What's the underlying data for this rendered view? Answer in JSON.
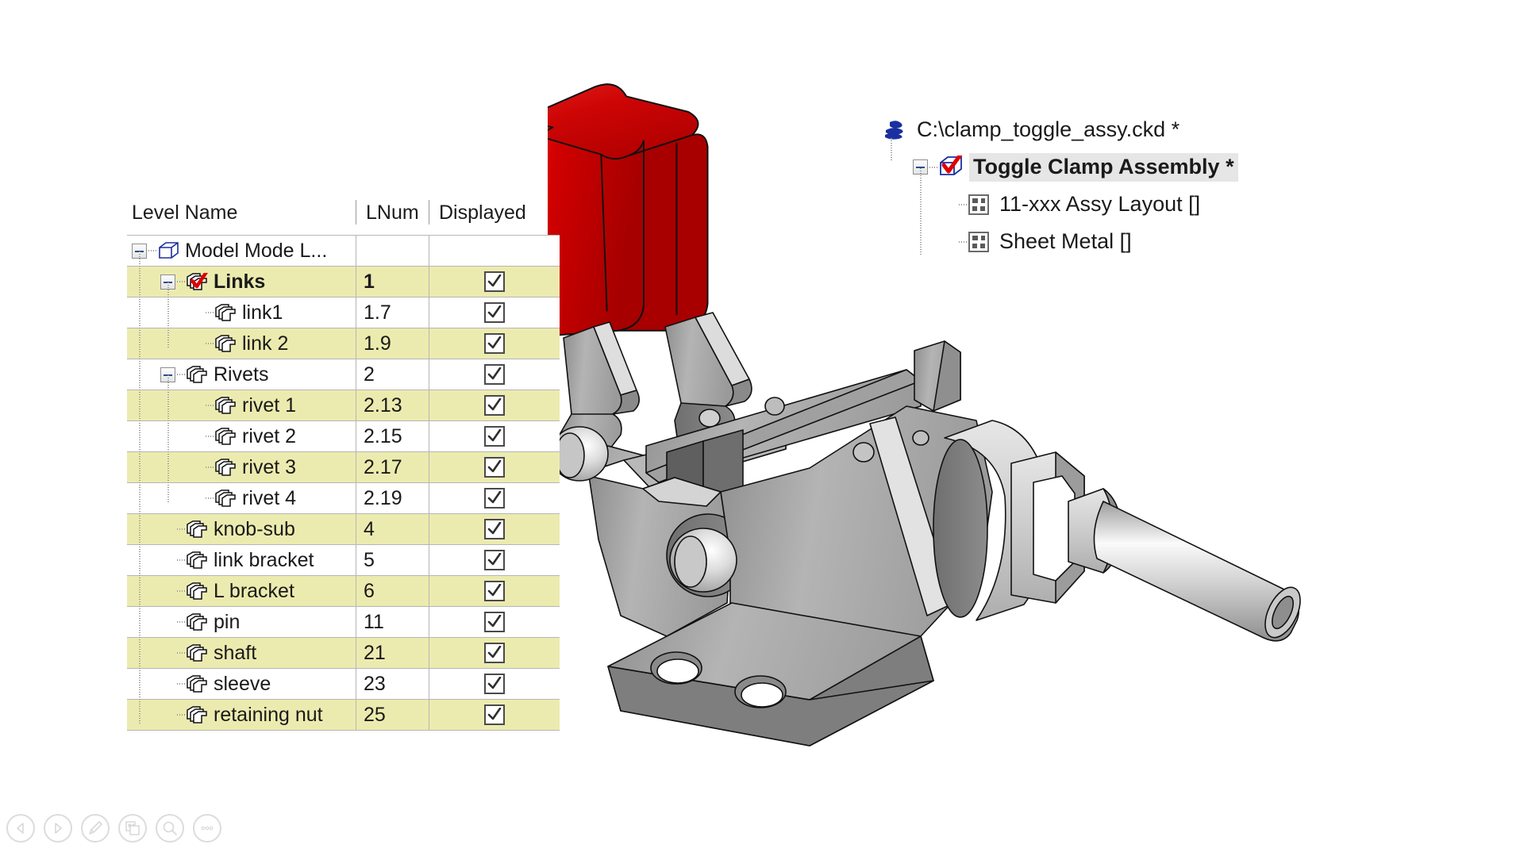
{
  "level_table": {
    "columns": [
      "Level Name",
      "LNum",
      "Displayed"
    ],
    "rows": [
      {
        "name": "Model Mode L...",
        "lnum": "",
        "displayed": false,
        "icon": "cube-icon",
        "depth": 0,
        "expander": "collapse",
        "bold": false,
        "alt": false,
        "has_check": false
      },
      {
        "name": "Links",
        "lnum": "1",
        "displayed": true,
        "icon": "stack-check-icon",
        "depth": 1,
        "expander": "collapse",
        "bold": true,
        "alt": true,
        "has_check": true
      },
      {
        "name": "link1",
        "lnum": "1.7",
        "displayed": true,
        "icon": "stack-icon",
        "depth": 2,
        "expander": "none",
        "bold": false,
        "alt": false,
        "has_check": true
      },
      {
        "name": "link 2",
        "lnum": "1.9",
        "displayed": true,
        "icon": "stack-icon",
        "depth": 2,
        "expander": "none",
        "bold": false,
        "alt": true,
        "has_check": true
      },
      {
        "name": "Rivets",
        "lnum": "2",
        "displayed": true,
        "icon": "stack-icon",
        "depth": 1,
        "expander": "collapse",
        "bold": false,
        "alt": false,
        "has_check": true
      },
      {
        "name": "rivet 1",
        "lnum": "2.13",
        "displayed": true,
        "icon": "stack-icon",
        "depth": 2,
        "expander": "none",
        "bold": false,
        "alt": true,
        "has_check": true
      },
      {
        "name": "rivet 2",
        "lnum": "2.15",
        "displayed": true,
        "icon": "stack-icon",
        "depth": 2,
        "expander": "none",
        "bold": false,
        "alt": false,
        "has_check": true
      },
      {
        "name": "rivet 3",
        "lnum": "2.17",
        "displayed": true,
        "icon": "stack-icon",
        "depth": 2,
        "expander": "none",
        "bold": false,
        "alt": true,
        "has_check": true
      },
      {
        "name": "rivet 4",
        "lnum": "2.19",
        "displayed": true,
        "icon": "stack-icon",
        "depth": 2,
        "expander": "none",
        "bold": false,
        "alt": false,
        "has_check": true
      },
      {
        "name": "knob-sub",
        "lnum": "4",
        "displayed": true,
        "icon": "stack-icon",
        "depth": 1,
        "expander": "none",
        "bold": false,
        "alt": true,
        "has_check": true
      },
      {
        "name": "link bracket",
        "lnum": "5",
        "displayed": true,
        "icon": "stack-icon",
        "depth": 1,
        "expander": "none",
        "bold": false,
        "alt": false,
        "has_check": true
      },
      {
        "name": "L bracket",
        "lnum": "6",
        "displayed": true,
        "icon": "stack-icon",
        "depth": 1,
        "expander": "none",
        "bold": false,
        "alt": true,
        "has_check": true
      },
      {
        "name": "pin",
        "lnum": "11",
        "displayed": true,
        "icon": "stack-icon",
        "depth": 1,
        "expander": "none",
        "bold": false,
        "alt": false,
        "has_check": true
      },
      {
        "name": "shaft",
        "lnum": "21",
        "displayed": true,
        "icon": "stack-icon",
        "depth": 1,
        "expander": "none",
        "bold": false,
        "alt": true,
        "has_check": true
      },
      {
        "name": "sleeve",
        "lnum": "23",
        "displayed": true,
        "icon": "stack-icon",
        "depth": 1,
        "expander": "none",
        "bold": false,
        "alt": false,
        "has_check": true
      },
      {
        "name": "retaining nut",
        "lnum": "25",
        "displayed": true,
        "icon": "stack-icon",
        "depth": 1,
        "expander": "none",
        "bold": false,
        "alt": true,
        "has_check": true
      }
    ]
  },
  "assembly_tree": {
    "nodes": [
      {
        "label": "C:\\clamp_toggle_assy.ckd *",
        "icon": "ckd-file-icon",
        "depth": 0,
        "expander": "none",
        "selected": false,
        "bold": false
      },
      {
        "label": "Toggle Clamp Assembly *",
        "icon": "cube-check-icon",
        "depth": 1,
        "expander": "collapse",
        "selected": true,
        "bold": true
      },
      {
        "label": "11-xxx Assy Layout []",
        "icon": "layout-icon",
        "depth": 2,
        "expander": "none",
        "selected": false,
        "bold": false
      },
      {
        "label": "Sheet Metal []",
        "icon": "layout-icon",
        "depth": 2,
        "expander": "none",
        "selected": false,
        "bold": false
      }
    ]
  },
  "model": {
    "name": "Toggle Clamp Assembly",
    "handle_color": "#D40000",
    "body_color": "#A8A8A8",
    "edge_color": "#1a1a1a"
  },
  "bottom_toolbar": {
    "buttons": [
      {
        "name": "back-button",
        "icon": "triangle-left-icon"
      },
      {
        "name": "forward-button",
        "icon": "triangle-right-icon"
      },
      {
        "name": "pen-button",
        "icon": "pen-icon"
      },
      {
        "name": "copy-button",
        "icon": "copy-icon"
      },
      {
        "name": "search-button",
        "icon": "magnifier-icon"
      },
      {
        "name": "more-button",
        "icon": "ellipsis-icon"
      }
    ]
  },
  "colors": {
    "row_highlight": "#ECEBAF",
    "grid_line": "#B6B6B6",
    "selection": "#E6E6E6",
    "tree_blue": "#1A2FA0",
    "check_red": "#E00000"
  }
}
